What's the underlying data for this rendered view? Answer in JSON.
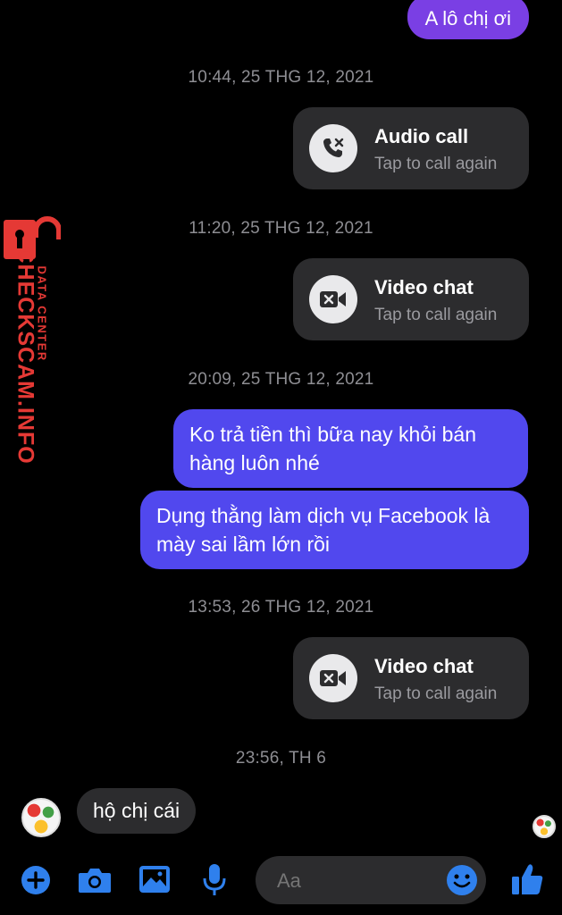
{
  "messages": {
    "top_bubble": "A lô chị ơi",
    "timestamps": [
      "10:44, 25 THG 12, 2021",
      "11:20, 25 THG 12, 2021",
      "20:09, 25 THG 12, 2021",
      "13:53, 26 THG 12, 2021",
      "23:56, TH 6"
    ],
    "calls": [
      {
        "title": "Audio call",
        "subtitle": "Tap to call again",
        "icon": "missed-audio-call-icon"
      },
      {
        "title": "Video chat",
        "subtitle": "Tap to call again",
        "icon": "missed-video-call-icon"
      },
      {
        "title": "Video chat",
        "subtitle": "Tap to call again",
        "icon": "missed-video-call-icon"
      }
    ],
    "outgoing": [
      "Ko trả tiền thì bữa nay khỏi bán hàng luôn nhé",
      "Dụng thằng làm dịch vụ Facebook là mày sai lầm lớn rồi"
    ],
    "incoming": "hộ chị cái"
  },
  "composer": {
    "placeholder": "Aa",
    "icons": [
      "plus-icon",
      "camera-icon",
      "gallery-icon",
      "microphone-icon",
      "emoji-icon",
      "thumbs-up-icon"
    ],
    "accent": "#2f80ed"
  },
  "watermark": {
    "brand": "CHECKSCAM.INFO",
    "tagline": "DATA CENTER",
    "color": "#e53935"
  },
  "colors": {
    "purple_bubble": "#7a3fe4",
    "blue_bubble": "#5148ee",
    "card": "#2c2c2e"
  }
}
